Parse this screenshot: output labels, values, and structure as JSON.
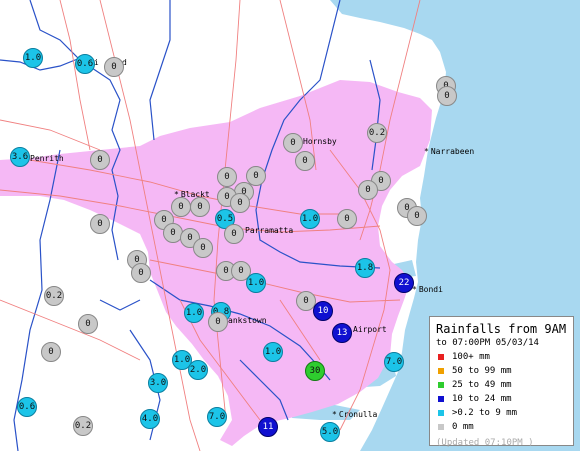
{
  "colors": {
    "ocean": "#a8d8f0",
    "urban": "#f5b8f5",
    "land": "#ffffff",
    "roads": "#f08080",
    "rivers": "#2a52c8",
    "grey": "#c8c8c8",
    "cyan": "#1cc4e8",
    "blue": "#1010d0",
    "green": "#2ecc2e",
    "orange": "#f0a000",
    "red": "#e82020"
  },
  "places": [
    {
      "name": "Ri",
      "star": false
    },
    {
      "name": "d",
      "star": false
    },
    {
      "name": "Penrith",
      "star": false
    },
    {
      "name": "Blackt",
      "star": true
    },
    {
      "name": "Hornsby",
      "star": false
    },
    {
      "name": "Narrabeen",
      "star": true
    },
    {
      "name": "Parramatta",
      "star": false
    },
    {
      "name": "Bondi",
      "star": true
    },
    {
      "name": "Airport",
      "star": false
    },
    {
      "name": "ankstown",
      "star": false
    },
    {
      "name": "Cronulla",
      "star": true
    }
  ],
  "stations": [
    {
      "v": "1.0",
      "c": "cyan"
    },
    {
      "v": "0.6",
      "c": "cyan"
    },
    {
      "v": "0",
      "c": "grey"
    },
    {
      "v": "3.6",
      "c": "cyan"
    },
    {
      "v": "0",
      "c": "grey"
    },
    {
      "v": "0",
      "c": "grey"
    },
    {
      "v": "0",
      "c": "grey"
    },
    {
      "v": "0",
      "c": "grey"
    },
    {
      "v": "0.2",
      "c": "grey"
    },
    {
      "v": "0",
      "c": "grey"
    },
    {
      "v": "0",
      "c": "grey"
    },
    {
      "v": "0",
      "c": "grey"
    },
    {
      "v": "0",
      "c": "grey"
    },
    {
      "v": "0",
      "c": "grey"
    },
    {
      "v": "0",
      "c": "grey"
    },
    {
      "v": "0",
      "c": "grey"
    },
    {
      "v": "0",
      "c": "grey"
    },
    {
      "v": "0",
      "c": "grey"
    },
    {
      "v": "0.5",
      "c": "cyan"
    },
    {
      "v": "0",
      "c": "grey"
    },
    {
      "v": "0",
      "c": "grey"
    },
    {
      "v": "0",
      "c": "grey"
    },
    {
      "v": "0",
      "c": "grey"
    },
    {
      "v": "0",
      "c": "grey"
    },
    {
      "v": "0",
      "c": "grey"
    },
    {
      "v": "0",
      "c": "grey"
    },
    {
      "v": "1.0",
      "c": "cyan"
    },
    {
      "v": "0",
      "c": "grey"
    },
    {
      "v": "0",
      "c": "grey"
    },
    {
      "v": "0",
      "c": "grey"
    },
    {
      "v": "0",
      "c": "grey"
    },
    {
      "v": "0",
      "c": "grey"
    },
    {
      "v": "0",
      "c": "grey"
    },
    {
      "v": "0",
      "c": "grey"
    },
    {
      "v": "1.0",
      "c": "cyan"
    },
    {
      "v": "1.8",
      "c": "cyan"
    },
    {
      "v": "22",
      "c": "blue"
    },
    {
      "v": "0.2",
      "c": "grey"
    },
    {
      "v": "0",
      "c": "grey"
    },
    {
      "v": "1.0",
      "c": "cyan"
    },
    {
      "v": "0.8",
      "c": "cyan"
    },
    {
      "v": "0",
      "c": "grey"
    },
    {
      "v": "0",
      "c": "grey"
    },
    {
      "v": "10",
      "c": "blue"
    },
    {
      "v": "13",
      "c": "blue"
    },
    {
      "v": "0",
      "c": "grey"
    },
    {
      "v": "1.0",
      "c": "cyan"
    },
    {
      "v": "1.0",
      "c": "cyan"
    },
    {
      "v": "2.0",
      "c": "cyan"
    },
    {
      "v": "3.0",
      "c": "cyan"
    },
    {
      "v": "30",
      "c": "green"
    },
    {
      "v": "7.0",
      "c": "cyan"
    },
    {
      "v": "0.6",
      "c": "cyan"
    },
    {
      "v": "4.0",
      "c": "cyan"
    },
    {
      "v": "7.0",
      "c": "cyan"
    },
    {
      "v": "0.2",
      "c": "grey"
    },
    {
      "v": "11",
      "c": "blue"
    },
    {
      "v": "5.0",
      "c": "cyan"
    }
  ],
  "legend": {
    "title": "Rainfalls from 9AM",
    "subtitle": "to 07:00PM 05/03/14",
    "rows": [
      {
        "label": "100+ mm",
        "color": "#e82020"
      },
      {
        "label": "50  to 99 mm",
        "color": "#f0a000"
      },
      {
        "label": "25  to 49 mm",
        "color": "#2ecc2e"
      },
      {
        "label": "10  to 24 mm",
        "color": "#1010d0"
      },
      {
        "label": ">0.2 to 9 mm",
        "color": "#1cc4e8"
      },
      {
        "label": "0 mm",
        "color": "#c8c8c8"
      }
    ],
    "updated": "(Updated 07:10PM  )"
  }
}
